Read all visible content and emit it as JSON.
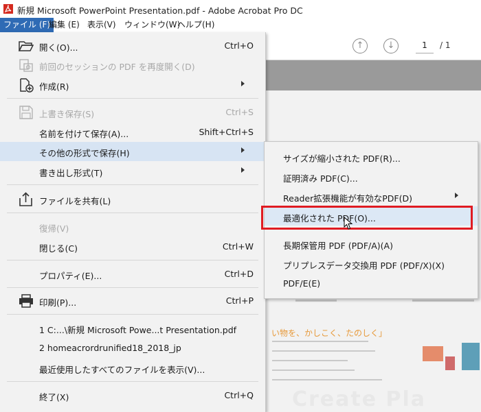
{
  "window": {
    "title": "新規 Microsoft PowerPoint Presentation.pdf - Adobe Acrobat Pro DC",
    "accent": "#2f6bb5"
  },
  "menubar": [
    {
      "label": "ファイル (F)",
      "active": true
    },
    {
      "label": "編集 (E)"
    },
    {
      "label": "表示(V)"
    },
    {
      "label": "ウィンドウ(W)"
    },
    {
      "label": "ヘルプ(H)"
    }
  ],
  "toolbar": {
    "prev_icon": "arrow-up-circle-icon",
    "next_icon": "arrow-down-circle-icon",
    "page_current": "1",
    "page_total": "/  1"
  },
  "file_menu": {
    "items": [
      {
        "label": "開く(O)...",
        "shortcut": "Ctrl+O",
        "icon": "folder-open-icon"
      },
      {
        "label": "前回のセッションの PDF を再度開く(D)",
        "disabled": true,
        "icon": "reopen-icon"
      },
      {
        "label": "作成(R)",
        "submenu": true,
        "icon": "create-pdf-icon"
      },
      {
        "label": "上書き保存(S)",
        "shortcut": "Ctrl+S",
        "disabled": true,
        "icon": "save-icon"
      },
      {
        "label": "名前を付けて保存(A)...",
        "shortcut": "Shift+Ctrl+S"
      },
      {
        "label": "その他の形式で保存(H)",
        "submenu": true,
        "hover": true
      },
      {
        "label": "書き出し形式(T)",
        "submenu": true
      },
      {
        "label": "ファイルを共有(L)",
        "icon": "share-icon"
      },
      {
        "label": "復帰(V)",
        "disabled": true
      },
      {
        "label": "閉じる(C)",
        "shortcut": "Ctrl+W"
      },
      {
        "label": "プロパティ(E)...",
        "shortcut": "Ctrl+D"
      },
      {
        "label": "印刷(P)...",
        "shortcut": "Ctrl+P",
        "icon": "printer-icon"
      },
      {
        "label": "1 C:...\\新規 Microsoft Powe...t Presentation.pdf"
      },
      {
        "label": "2 homeacrordrunified18_2018_jp"
      },
      {
        "label": "最近使用したすべてのファイルを表示(V)..."
      },
      {
        "label": "終了(X)",
        "shortcut": "Ctrl+Q"
      }
    ]
  },
  "save_as_other_submenu": {
    "items": [
      {
        "label": "サイズが縮小された PDF(R)..."
      },
      {
        "label": "証明済み PDF(C)..."
      },
      {
        "label": "Reader拡張機能が有効なPDF(D)",
        "submenu": true
      },
      {
        "label": "最適化された PDF(O)...",
        "hover": true,
        "highlighted": true,
        "highlight_color": "#e01b22"
      },
      {
        "label": "長期保管用 PDF (PDF/A)(A)"
      },
      {
        "label": "プリプレスデータ交換用 PDF (PDF/X)(X)"
      },
      {
        "label": "PDF/E(E)"
      }
    ]
  },
  "preview": {
    "tagline": "い物を、かしこく、たのしく」",
    "watermark": "Create Pla"
  }
}
